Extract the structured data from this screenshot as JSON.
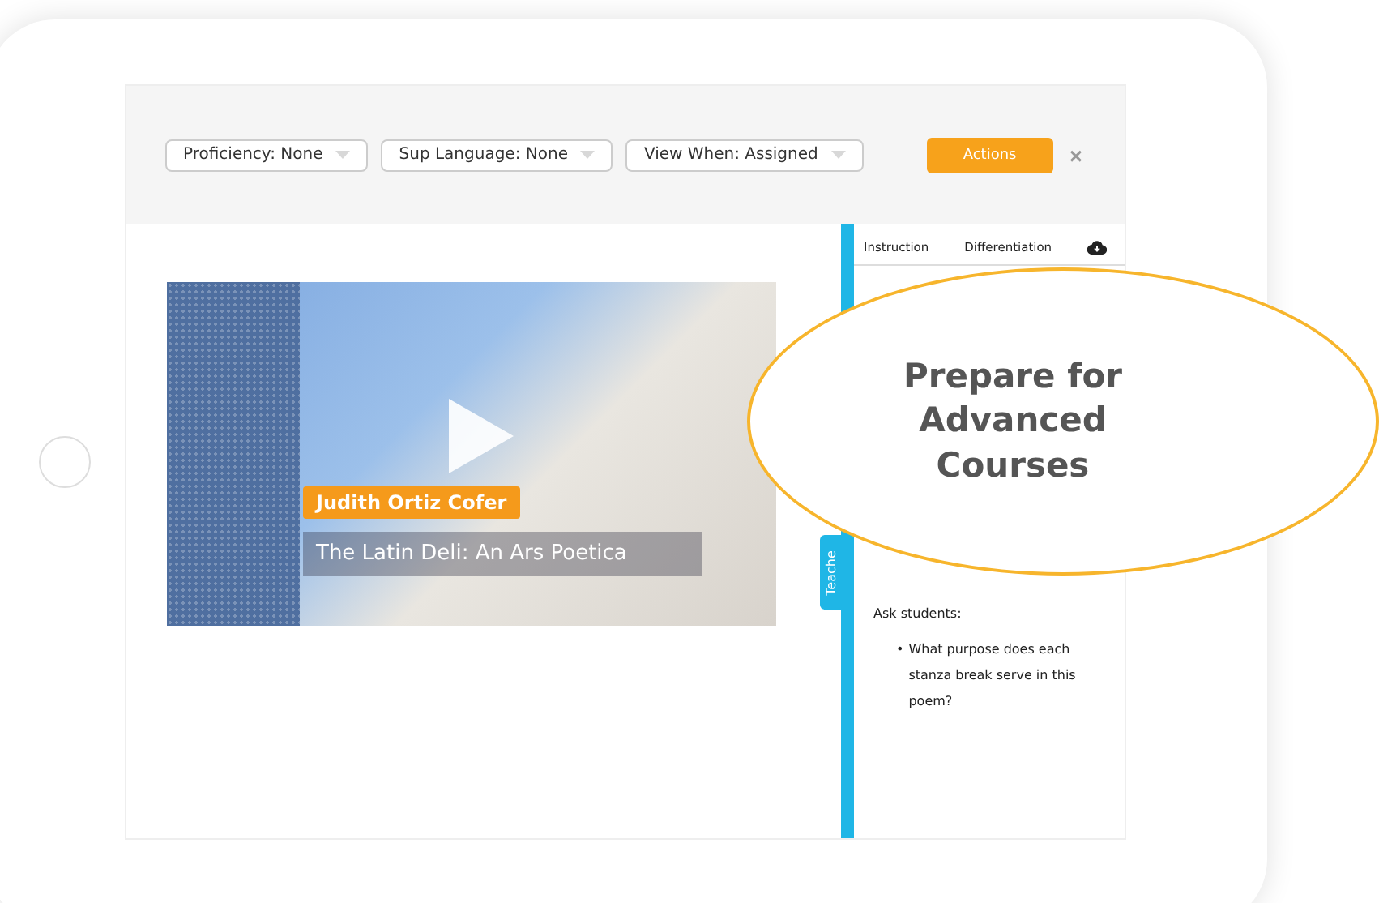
{
  "toolbar": {
    "filters": [
      {
        "label": "Proficiency: None"
      },
      {
        "label": "Sup Language: None"
      },
      {
        "label": "View When: Assigned"
      }
    ],
    "actions_button": "Actions",
    "close": "×"
  },
  "video": {
    "author": "Judith Ortiz Cofer",
    "title": "The Latin Deli: An Ars Poetica"
  },
  "side_tab": "Teache",
  "panel": {
    "tabs": [
      {
        "label": "Instruction"
      },
      {
        "label": "Differentiation"
      }
    ],
    "prompt": "Ask students:",
    "bullet_marker": "•",
    "bullets": [
      "What purpose does each stanza break serve in this poem?"
    ]
  },
  "callout": "Prepare for Advanced Courses"
}
